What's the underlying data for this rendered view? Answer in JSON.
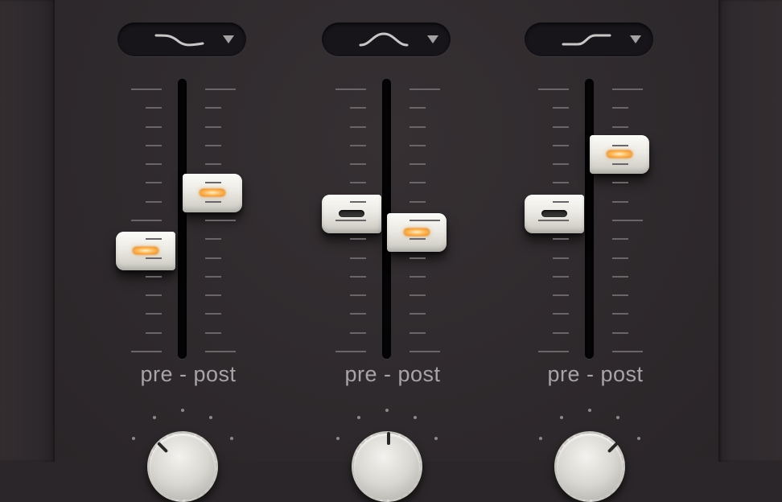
{
  "channels": [
    {
      "id": "ch1",
      "filter_icon": "low-pass-curve-icon",
      "routing_label": "pre - post",
      "pre_level": 0.38,
      "post_level": 0.6,
      "pre_led": "on",
      "post_led": "on",
      "knob_position": "left"
    },
    {
      "id": "ch2",
      "filter_icon": "band-pass-curve-icon",
      "routing_label": "pre - post",
      "pre_level": 0.52,
      "post_level": 0.45,
      "pre_led": "off",
      "post_led": "on",
      "knob_position": "center"
    },
    {
      "id": "ch3",
      "filter_icon": "high-pass-curve-icon",
      "routing_label": "pre - post",
      "pre_level": 0.52,
      "post_level": 0.75,
      "pre_led": "off",
      "post_led": "on",
      "knob_position": "right"
    }
  ],
  "colors": {
    "background": "#2f2a2d",
    "led_on": "#ffb85a",
    "label": "#a9a4a6"
  }
}
